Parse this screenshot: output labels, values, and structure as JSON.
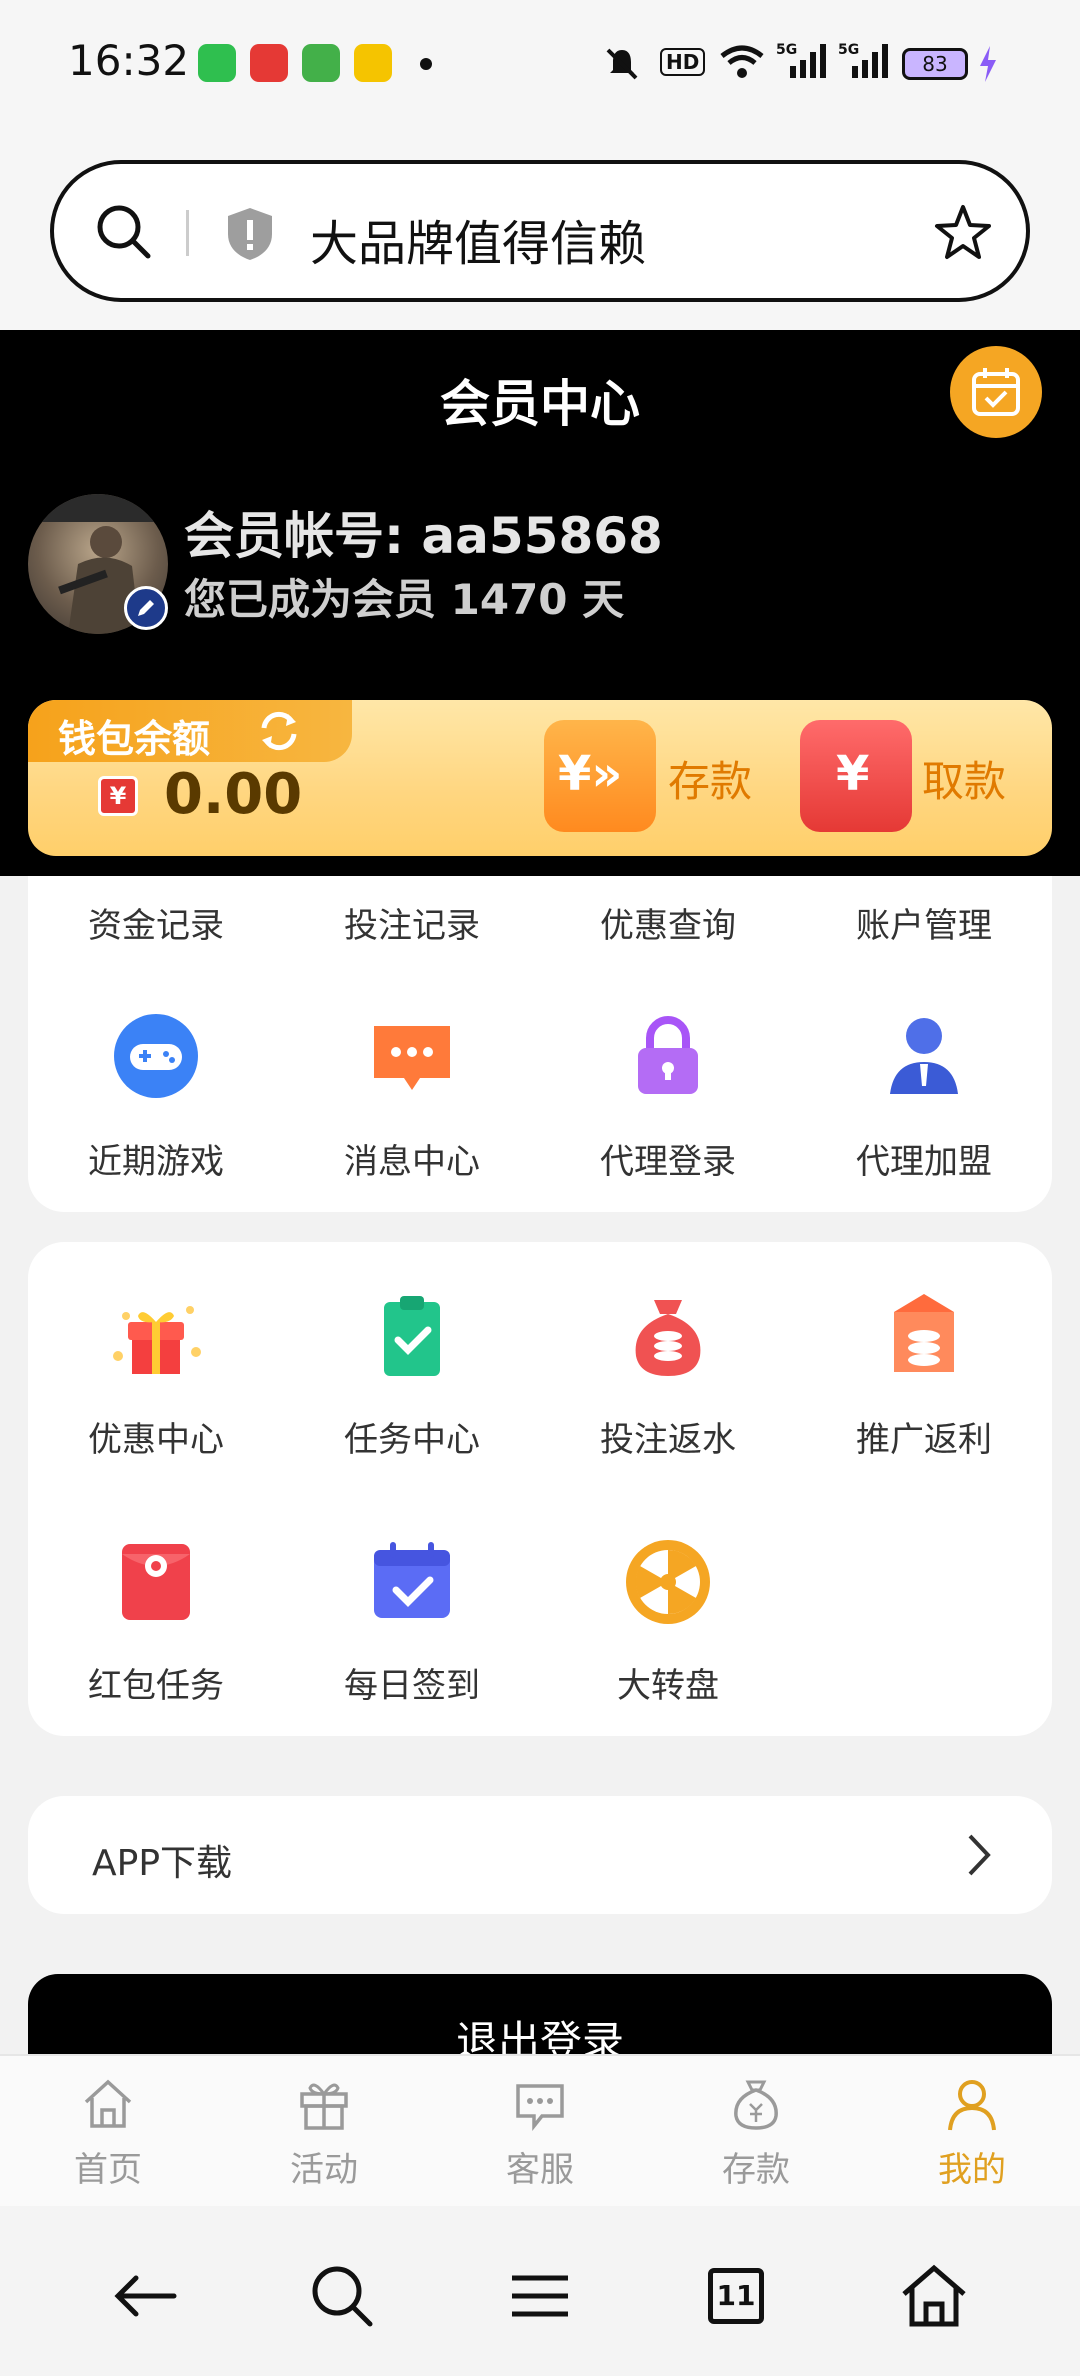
{
  "status_bar": {
    "time": "16:32",
    "apps": [
      "green-app-icon",
      "toutiao-icon",
      "messages-icon",
      "yellow-app-icon"
    ],
    "battery": "83",
    "network": "5G"
  },
  "browser": {
    "search_text": "大品牌值得信赖"
  },
  "header": {
    "title": "会员中心",
    "account_label": "会员帐号: aa55868",
    "member_days": "您已成为会员 1470 天"
  },
  "wallet": {
    "title": "钱包余额",
    "currency_symbol": "¥",
    "balance": "0.00",
    "deposit_label": "存款",
    "withdraw_label": "取款",
    "deposit_icon_text": "¥»",
    "withdraw_icon_text": "¥"
  },
  "menu_row1": [
    "资金记录",
    "投注记录",
    "优惠查询",
    "账户管理"
  ],
  "menu_row2": [
    "近期游戏",
    "消息中心",
    "代理登录",
    "代理加盟"
  ],
  "menu_row3": [
    "优惠中心",
    "任务中心",
    "投注返水",
    "推广返利"
  ],
  "menu_row4": [
    "红包任务",
    "每日签到",
    "大转盘"
  ],
  "app_download": "APP下载",
  "logout": "退出登录",
  "tabs": [
    "首页",
    "活动",
    "客服",
    "存款",
    "我的"
  ],
  "active_tab": "我的",
  "sysnav": {
    "tabs_count": "11"
  },
  "colors": {
    "accent": "#e0a020",
    "header_bg": "#000000",
    "wallet_bg": "#ffd680"
  }
}
